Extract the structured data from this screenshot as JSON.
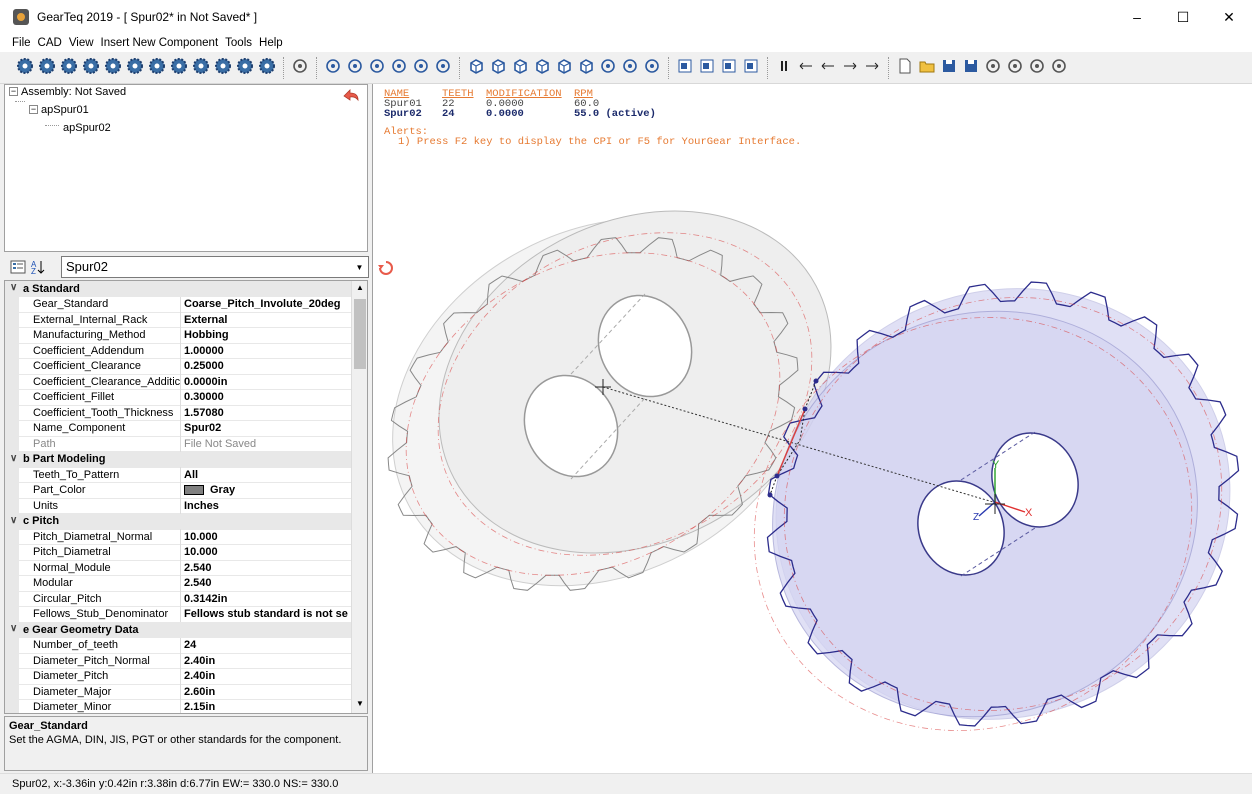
{
  "window": {
    "title": "GearTeq 2019 - [ Spur02*  in  Not Saved* ]",
    "min": "–",
    "max": "☐",
    "close": "✕"
  },
  "menu": [
    "File",
    "CAD",
    "View",
    "Insert New Component",
    "Tools",
    "Help"
  ],
  "tree": {
    "root": "Assembly: Not Saved",
    "child": "apSpur01",
    "grandchild": "apSpur02"
  },
  "property_selector": {
    "value": "Spur02"
  },
  "properties": [
    {
      "type": "cat",
      "label": "a Standard"
    },
    {
      "type": "prop",
      "name": "Gear_Standard",
      "value": "Coarse_Pitch_Involute_20deg"
    },
    {
      "type": "prop",
      "name": "External_Internal_Rack",
      "value": "External"
    },
    {
      "type": "prop",
      "name": "Manufacturing_Method",
      "value": "Hobbing"
    },
    {
      "type": "prop",
      "name": "Coefficient_Addendum",
      "value": "1.00000"
    },
    {
      "type": "prop",
      "name": "Coefficient_Clearance",
      "value": "0.25000"
    },
    {
      "type": "prop",
      "name": "Coefficient_Clearance_Additic",
      "value": "0.0000in"
    },
    {
      "type": "prop",
      "name": "Coefficient_Fillet",
      "value": "0.30000"
    },
    {
      "type": "prop",
      "name": "Coefficient_Tooth_Thickness",
      "value": "1.57080"
    },
    {
      "type": "prop",
      "name": "Name_Component",
      "value": "Spur02"
    },
    {
      "type": "prop",
      "name": "Path",
      "value": "File Not Saved",
      "grey": true
    },
    {
      "type": "cat",
      "label": "b Part Modeling"
    },
    {
      "type": "prop",
      "name": "Teeth_To_Pattern",
      "value": "All"
    },
    {
      "type": "prop",
      "name": "Part_Color",
      "value": "Gray",
      "swatch": "#808080"
    },
    {
      "type": "prop",
      "name": "Units",
      "value": "Inches"
    },
    {
      "type": "cat",
      "label": "c Pitch"
    },
    {
      "type": "prop",
      "name": "Pitch_Diametral_Normal",
      "value": "10.000"
    },
    {
      "type": "prop",
      "name": "Pitch_Diametral",
      "value": "10.000"
    },
    {
      "type": "prop",
      "name": "Normal_Module",
      "value": "2.540"
    },
    {
      "type": "prop",
      "name": "Modular",
      "value": "2.540"
    },
    {
      "type": "prop",
      "name": "Circular_Pitch",
      "value": "0.3142in"
    },
    {
      "type": "prop",
      "name": "Fellows_Stub_Denominator",
      "value": "Fellows stub standard is not se"
    },
    {
      "type": "cat",
      "label": "e Gear Geometry Data"
    },
    {
      "type": "prop",
      "name": "Number_of_teeth",
      "value": "24"
    },
    {
      "type": "prop",
      "name": "Diameter_Pitch_Normal",
      "value": "2.40in"
    },
    {
      "type": "prop",
      "name": "Diameter_Pitch",
      "value": "2.40in"
    },
    {
      "type": "prop",
      "name": "Diameter_Major",
      "value": "2.60in"
    },
    {
      "type": "prop",
      "name": "Diameter_Minor",
      "value": "2.15in"
    }
  ],
  "description": {
    "title": "Gear_Standard",
    "text": "Set the AGMA, DIN, JIS, PGT or other standards for the component."
  },
  "status": {
    "text": "Spur02,  x:-3.36in  y:0.42in  r:3.38in  d:6.77in    EW:= 330.0  NS:= 330.0"
  },
  "viewport": {
    "headers": [
      "NAME",
      "TEETH",
      "MODIFICATION",
      "RPM"
    ],
    "gears": [
      {
        "name": "Spur01",
        "teeth": "22",
        "modification": "0.0000",
        "rpm": "60.0"
      },
      {
        "name": "Spur02",
        "teeth": "24",
        "modification": "0.0000",
        "rpm": "55.0 (active)"
      }
    ],
    "alerts_title": "Alerts:",
    "alert1": "1) Press F2 key to display the CPI or F5 for YourGear Interface."
  },
  "colors": {
    "accent_orange": "#e67a32",
    "gear1_stroke": "#777777",
    "gear2_stroke": "#2c2c8c",
    "gear2_fill": "#c8c8ee",
    "pitch_red": "#d84040"
  }
}
